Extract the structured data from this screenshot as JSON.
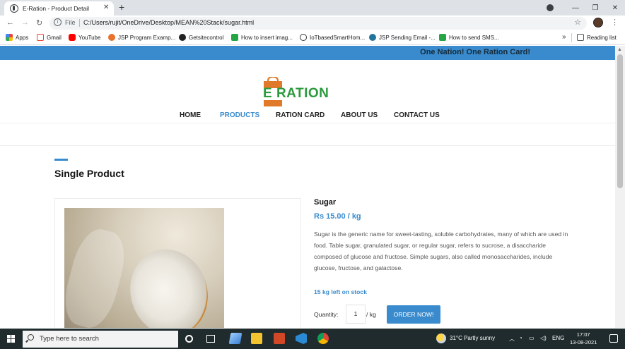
{
  "browser": {
    "tab_title": "E-Ration - Product Detail",
    "tab_close": "✕",
    "new_tab": "+",
    "window_controls": {
      "minimize": "—",
      "maximize": "❐",
      "close": "✕"
    },
    "file_label": "File",
    "url": "C:/Users/rujit/OneDrive/Desktop/MEAN%20Stack/sugar.html",
    "nav": {
      "back": "←",
      "forward": "→",
      "reload": "↻"
    },
    "star": "☆",
    "menu": "⋮"
  },
  "bookmarks": {
    "items": [
      {
        "label": "Apps",
        "icon": "apps-grid-icon",
        "color": "#e8453c"
      },
      {
        "label": "Gmail",
        "icon": "gmail-icon",
        "color": "#ea4335"
      },
      {
        "label": "YouTube",
        "icon": "youtube-icon",
        "color": "#ff0000"
      },
      {
        "label": "JSP Program Examp...",
        "icon": "site-icon",
        "color": "#e8712b"
      },
      {
        "label": "Getsitecontrol",
        "icon": "getsitecontrol-icon",
        "color": "#222222"
      },
      {
        "label": "How to insert imag...",
        "icon": "s-icon",
        "color": "#26a544"
      },
      {
        "label": "IoTbasedSmartHom...",
        "icon": "globe-icon",
        "color": "#333333"
      },
      {
        "label": "JSP Sending Email -...",
        "icon": "wordpress-icon",
        "color": "#21759b"
      },
      {
        "label": "How to send SMS...",
        "icon": "s-icon",
        "color": "#26a544"
      }
    ],
    "more": "»",
    "reading_list": "Reading list"
  },
  "site": {
    "tagline": "One Nation! One Ration Card!",
    "logo_text": "E RATION",
    "nav": [
      "HOME",
      "PRODUCTS",
      "RATION CARD",
      "ABOUT US",
      "CONTACT US"
    ],
    "active_nav": "PRODUCTS",
    "section_title": "Single Product",
    "accent_color": "#3a8bcd"
  },
  "product": {
    "name": "Sugar",
    "price": "Rs 15.00 / kg",
    "description": "Sugar is the generic name for sweet-tasting, soluble carbohydrates, many of which are used in food. Table sugar, granulated sugar, or regular sugar, refers to sucrose, a disaccharide composed of glucose and fructose. Simple sugars, also called monosaccharides, include glucose, fructose, and galactose.",
    "stock": "15 kg left on stock",
    "quantity_label": "Quantity:",
    "quantity_value": "1",
    "unit": "/ kg",
    "order_button": "ORDER NOW!"
  },
  "taskbar": {
    "search_placeholder": "Type here to search",
    "weather": "31°C  Partly sunny",
    "language": "ENG",
    "time": "17:07",
    "date": "13-08-2021"
  }
}
